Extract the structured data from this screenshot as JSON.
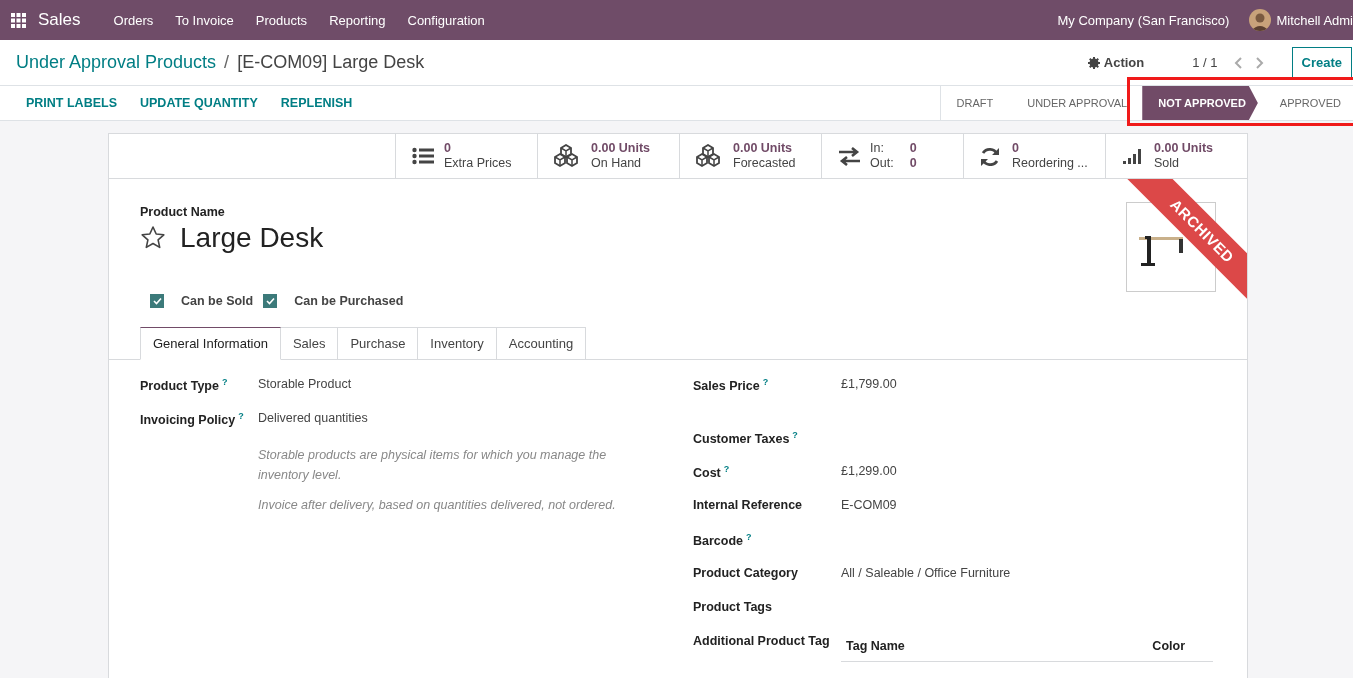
{
  "navbar": {
    "app": "Sales",
    "menu": [
      "Orders",
      "To Invoice",
      "Products",
      "Reporting",
      "Configuration"
    ],
    "company": "My Company (San Francisco)",
    "user": "Mitchell Admi"
  },
  "breadcrumbs": [
    "Under Approval Products",
    "[E-COM09] Large Desk"
  ],
  "breadcrumb_separator": "/",
  "action": "Action",
  "pager": "1 / 1",
  "create": "Create",
  "header_buttons": [
    "PRINT LABELS",
    "UPDATE QUANTITY",
    "REPLENISH"
  ],
  "stages": [
    {
      "label": "DRAFT",
      "selected": false,
      "highlighted": false
    },
    {
      "label": "UNDER APPROVAL",
      "selected": false,
      "highlighted": false
    },
    {
      "label": "NOT APPROVED",
      "selected": true,
      "highlighted": true
    },
    {
      "label": "APPROVED",
      "selected": false,
      "highlighted": true
    }
  ],
  "stat_buttons": [
    {
      "kind": "count",
      "value": "0",
      "label": "Extra Prices"
    },
    {
      "kind": "count",
      "value": "0.00 Units",
      "label": "On Hand"
    },
    {
      "kind": "count",
      "value": "0.00 Units",
      "label": "Forecasted"
    },
    {
      "kind": "inout",
      "rows": [
        [
          "In:",
          "0"
        ],
        [
          "Out:",
          "0"
        ]
      ]
    },
    {
      "kind": "count",
      "value": "0",
      "label": "Reordering ..."
    },
    {
      "kind": "count",
      "value": "0.00 Units",
      "label": "Sold"
    }
  ],
  "ribbon": "ARCHIVED",
  "product": {
    "name_label": "Product Name",
    "name": "Large Desk",
    "favorite": false
  },
  "checkboxes": [
    {
      "label": "Can be Sold",
      "checked": true
    },
    {
      "label": "Can be Purchased",
      "checked": true
    }
  ],
  "tabs": [
    {
      "label": "General Information",
      "selected": true
    },
    {
      "label": "Sales",
      "selected": false
    },
    {
      "label": "Purchase",
      "selected": false
    },
    {
      "label": "Inventory",
      "selected": false
    },
    {
      "label": "Accounting",
      "selected": false
    }
  ],
  "left_fields": [
    {
      "label": "Product Type",
      "help": "?",
      "value": "Storable Product"
    },
    {
      "label": "Invoicing Policy",
      "help": "?",
      "value": "Delivered quantities"
    }
  ],
  "notes": [
    "Storable products are physical items for which you manage the inventory level.",
    "Invoice after delivery, based on quantities delivered, not ordered."
  ],
  "right_fields": [
    {
      "label": "Sales Price",
      "help": "?",
      "value": "£1,799.00"
    },
    {
      "label": "Customer Taxes",
      "help": "?"
    },
    {
      "label": "Cost",
      "help": "?",
      "value": "£1,299.00"
    },
    {
      "label": "Internal Reference",
      "value": "E-COM09"
    },
    {
      "label": "Barcode",
      "help": "?"
    },
    {
      "label": "Product Category",
      "value": "All / Saleable / Office Furniture"
    },
    {
      "label": "Product Tags"
    }
  ],
  "tag_table": {
    "label": "Additional Product Tag",
    "columns": [
      "Tag Name",
      "Color"
    ]
  }
}
